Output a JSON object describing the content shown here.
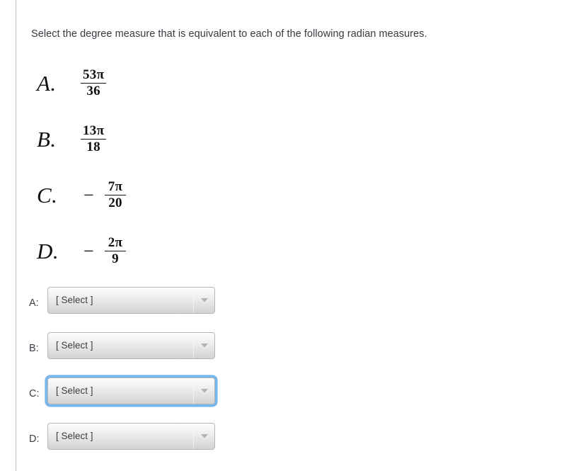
{
  "prompt": "Select the degree measure that is equivalent to each of the following radian measures.",
  "problems": [
    {
      "label": "A.",
      "sign": "",
      "numerator": "53π",
      "numerator_digits": "53",
      "denominator": "36"
    },
    {
      "label": "B.",
      "sign": "",
      "numerator": "13π",
      "numerator_digits": "13",
      "denominator": "18"
    },
    {
      "label": "C.",
      "sign": "−",
      "numerator": "7π",
      "numerator_digits": "7",
      "denominator": "20"
    },
    {
      "label": "D.",
      "sign": "−",
      "numerator": "2π",
      "numerator_digits": "2",
      "denominator": "9"
    }
  ],
  "answers": [
    {
      "row_label": "A:",
      "value": "[ Select ]",
      "focused": false,
      "arrow_icon": "chevron-down-icon"
    },
    {
      "row_label": "B:",
      "value": "[ Select ]",
      "focused": false,
      "arrow_icon": "chevron-down-icon"
    },
    {
      "row_label": "C:",
      "value": "[ Select ]",
      "focused": true,
      "arrow_icon": "chevron-down-icon"
    },
    {
      "row_label": "D:",
      "value": "[ Select ]",
      "focused": false,
      "arrow_icon": "chevron-down-icon"
    }
  ],
  "colors": {
    "focus_ring": "#75b6ec",
    "text": "#353b41",
    "divider": "#b9bcc0",
    "select_border": "#b7b7b7",
    "background": "#ffffff"
  },
  "pi_symbol": "π",
  "minus_symbol": "−"
}
